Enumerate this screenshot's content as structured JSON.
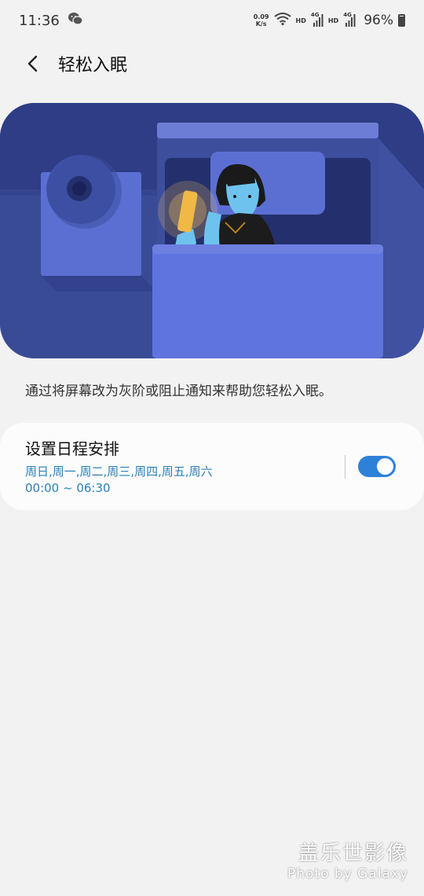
{
  "status_bar": {
    "time": "11:36",
    "net_speed_value": "0.09",
    "net_speed_unit": "K/s",
    "hd1": "HD",
    "g1": "4G",
    "hd2": "HD",
    "g2": "4G",
    "battery": "96%"
  },
  "header": {
    "title": "轻松入眠"
  },
  "description": "通过将屏幕改为灰阶或阻止通知来帮助您轻松入眠。",
  "schedule": {
    "title": "设置日程安排",
    "days": "周日,周一,周二,周三,周四,周五,周六",
    "time_range": "00:00 ~ 06:30",
    "enabled": true
  },
  "watermark": {
    "title": "盖乐世影像",
    "subtitle": "Photo by Galaxy"
  },
  "colors": {
    "accent": "#2f80d8",
    "schedule_text": "#2a7fb8",
    "illustration_bg": "#3a4b96"
  }
}
